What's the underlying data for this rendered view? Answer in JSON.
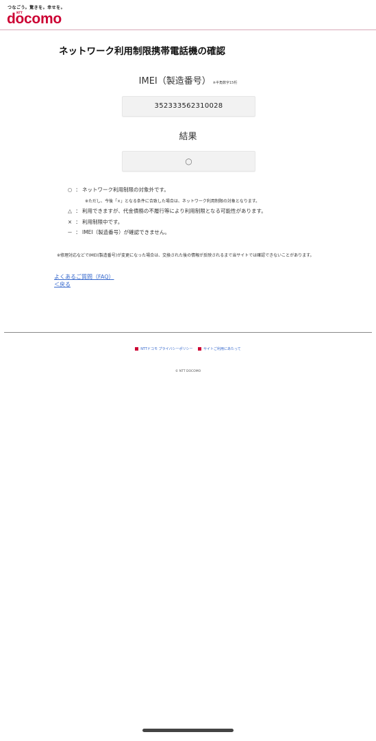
{
  "header": {
    "tagline": "つなごう。驚きを。幸せを。",
    "ntt_mark": "NTT",
    "logo_text": "docomo",
    "brand_color": "#cc0033"
  },
  "main": {
    "title": "ネットワーク利用制限携帯電話機の確認",
    "imei_label": "IMEI（製造番号）",
    "imei_note": "※半角数字15桁",
    "imei_value": "352333562310028",
    "result_heading": "結果",
    "result_value": "○"
  },
  "legend": [
    {
      "symbol": "○",
      "text": "ネットワーク利用制限の対象外です。"
    },
    {
      "symbol": "△",
      "text": "利用できますが、代金債務の不履行等により利用制限となる可能性があります。"
    },
    {
      "symbol": "×",
      "text": "利用制限中です。"
    },
    {
      "symbol": "－",
      "text": "IMEI（製造番号）が確認できません。"
    }
  ],
  "legend_sub": "※ただし、今後「×」となる条件に合致した場合は、ネットワーク利用制限の対象となります。",
  "legend_separator": "：",
  "note": "※修理対応などでIMEI(製造番号)が変更になった場合は、交換された後の情報が反映されるまで当サイトでは確認できないことがあります。",
  "links": {
    "faq": "よくあるご質問（FAQ）",
    "back": "＜戻る"
  },
  "footer": {
    "privacy": "NTTドコモ プライバシーポリシー",
    "site_usage": "サイトご利用にあたって",
    "copyright": "© NTT DOCOMO"
  }
}
